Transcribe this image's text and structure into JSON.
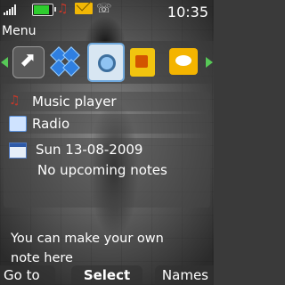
{
  "status": {
    "time": "10:35",
    "battery_level": 0.85,
    "icons": [
      "signal-icon",
      "battery-icon",
      "music-note-icon",
      "mail-icon",
      "ringtone-icon"
    ]
  },
  "title": "Menu",
  "carousel": {
    "icons": [
      "shortcut-icon",
      "apps-icon",
      "camera-icon",
      "sim-card-icon",
      "messages-icon"
    ],
    "selected": "camera-icon"
  },
  "items": [
    {
      "label": "Music player",
      "icon": "music-player-icon"
    },
    {
      "label": "Radio",
      "icon": "radio-icon"
    }
  ],
  "calendar": {
    "date": "Sun 13-08-2009",
    "notes": "No upcoming notes"
  },
  "note": {
    "line1": "You can make your own",
    "line2": "note here"
  },
  "softkeys": {
    "left": "Go to",
    "middle": "Select",
    "right": "Names"
  },
  "colors": {
    "accent_arrow": "#57c957",
    "battery": "#2ecc2e"
  }
}
